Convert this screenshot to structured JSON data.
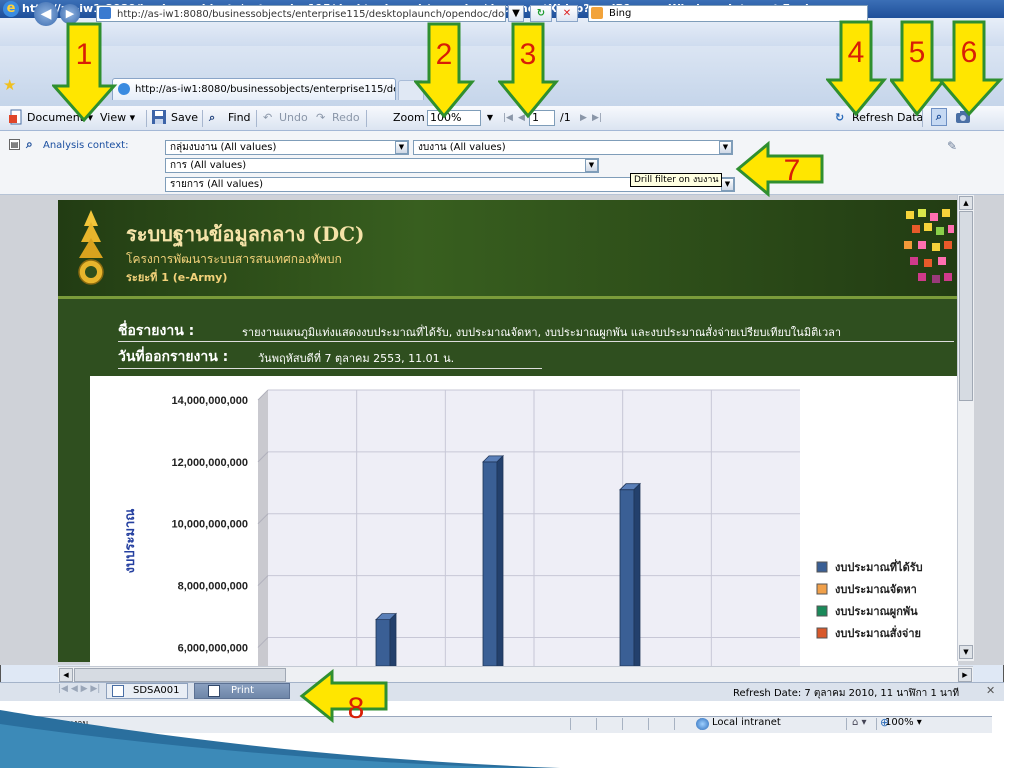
{
  "browser": {
    "title": "http://as-iw1:8080/businessobjects/enterprise115/desktoplaunch/opendoc/documentXI.jsp?cmdP1=un - Windows Internet Explorer",
    "address": "http://as-iw1:8080/businessobjects/enterprise115/desktoplaunch/opendoc/documentXI.jsp?cmdP1=untitl",
    "search_engine": "Bing",
    "tab_title": "http://as-iw1:8080/businessobjects/enterprise115/de..."
  },
  "toolbar": {
    "document": "Document",
    "view": "View",
    "save": "Save",
    "find": "Find",
    "undo": "Undo",
    "redo": "Redo",
    "zoom_label": "Zoom",
    "zoom_value": "100%",
    "page_value": "1",
    "page_total": "/1",
    "refresh_data": "Refresh Data"
  },
  "analysis": {
    "label": "Analysis context:",
    "filters": [
      "กลุ่มงบงาน (All values)",
      "งบงาน (All values)",
      "การ (All values)",
      "รายการ (All values)"
    ],
    "tooltip": "Drill filter on งบงาน"
  },
  "report": {
    "banner_title": "ระบบฐานข้อมูลกลาง (DC)",
    "banner_sub1": "โครงการพัฒนาระบบสารสนเทศกองทัพบก",
    "banner_sub2": "ระยะที่ 1 (e-Army)",
    "name_label": "ชื่อรายงาน :",
    "name_value": "รายงานแผนภูมิแท่งแสดงงบประมาณที่ได้รับ, งบประมาณจัดหา, งบประมาณผูกพัน และงบประมาณสั่งจ่ายเปรียบเทียบในมิติเวลา",
    "date_label": "วันที่ออกรายงาน :",
    "date_value": "วันพฤหัสบดีที่ 7 ตุลาคม 2553,  11.01 น."
  },
  "chart_data": {
    "type": "bar",
    "ylabel": "งบประมาณ",
    "y_ticks": [
      "6,000,000,000",
      "8,000,000,000",
      "10,000,000,000",
      "12,000,000,000",
      "14,000,000,000"
    ],
    "ylim_visible": [
      5400000000,
      14000000000
    ],
    "series": [
      {
        "name": "งบประมาณที่ได้รับ",
        "color": "#3a5f95",
        "values": [
          6900000000,
          12000000000,
          11100000000
        ]
      },
      {
        "name": "งบประมาณจัดหา",
        "color": "#f0a04a",
        "values": []
      },
      {
        "name": "งบประมาณผูกพัน",
        "color": "#1a8a5a",
        "values": []
      },
      {
        "name": "งบประมาณสั่งจ่าย",
        "color": "#d8582a",
        "values": []
      }
    ]
  },
  "report_tabs": {
    "tab1": "SDSA001",
    "tab2": "Print",
    "refresh_date": "Refresh Date: 7 ตุลาคม 2010, 11 นาฬิกา 1 นาที"
  },
  "status": {
    "text": "Drill filter on งบงาน",
    "zone": "Local intranet",
    "zoom": "100%"
  },
  "callouts": [
    "1",
    "2",
    "3",
    "4",
    "5",
    "6",
    "7",
    "8"
  ],
  "colors": {
    "callout_fill": "#ffe600",
    "callout_border": "#2f8f2f",
    "callout_text": "#d81e06"
  }
}
